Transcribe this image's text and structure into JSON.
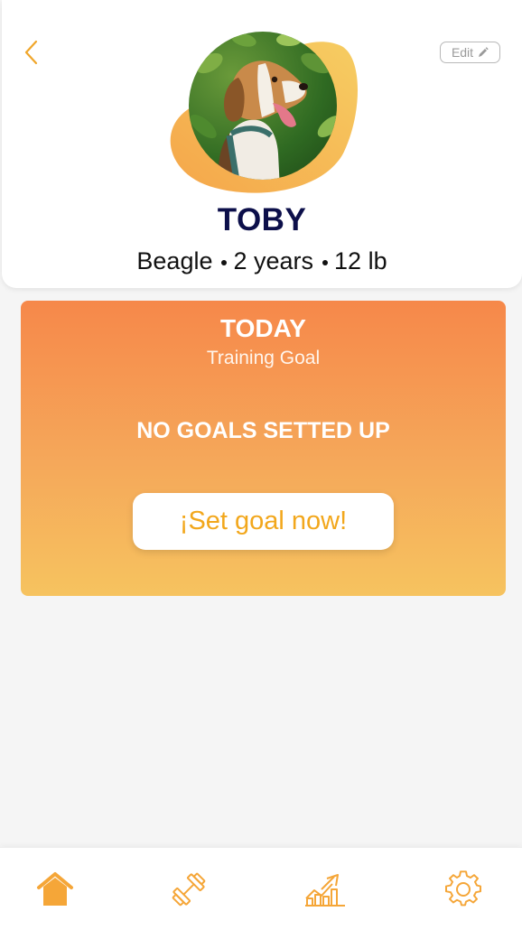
{
  "header": {
    "back_icon": "chevron-left-icon",
    "edit_label": "Edit",
    "edit_icon": "pencil-icon"
  },
  "pet": {
    "name": "TOBY",
    "breed": "Beagle",
    "age": "2 years",
    "weight": "12 lb",
    "photo": "beagle-dog-photo"
  },
  "today": {
    "title": "TODAY",
    "subtitle": "Training Goal",
    "empty_message": "NO GOALS SETTED UP",
    "cta_label": "¡Set goal now!"
  },
  "nav": {
    "items": [
      {
        "icon": "home-icon",
        "active": true
      },
      {
        "icon": "dumbbell-icon",
        "active": false
      },
      {
        "icon": "stats-chart-icon",
        "active": false
      },
      {
        "icon": "gear-icon",
        "active": false
      }
    ]
  },
  "colors": {
    "accent": "#f5a623",
    "accent_light": "#f6c35f",
    "gradient_top": "#f6884a",
    "name_color": "#0c0f4a",
    "background": "#f5f5f5"
  }
}
